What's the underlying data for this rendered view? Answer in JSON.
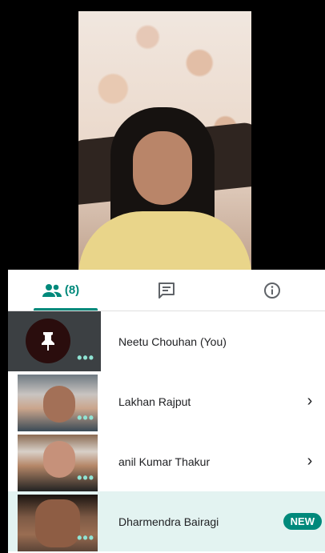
{
  "tabs": {
    "people_count": "(8)",
    "people_icon": "people-icon",
    "chat_icon": "chat-icon",
    "info_icon": "info-icon"
  },
  "participants": [
    {
      "name": "Neetu Chouhan (You)",
      "avatar": "push-pin-icon",
      "chevron": "",
      "badge": ""
    },
    {
      "name": "Lakhan Rajput",
      "avatar": "video-thumbnail",
      "chevron": "›",
      "badge": ""
    },
    {
      "name": "anil Kumar Thakur",
      "avatar": "video-thumbnail",
      "chevron": "›",
      "badge": ""
    },
    {
      "name": "Dharmendra Bairagi",
      "avatar": "video-thumbnail",
      "chevron": "",
      "badge": "NEW"
    }
  ],
  "colors": {
    "accent": "#00897b",
    "highlight_row": "#e3f3f1"
  }
}
